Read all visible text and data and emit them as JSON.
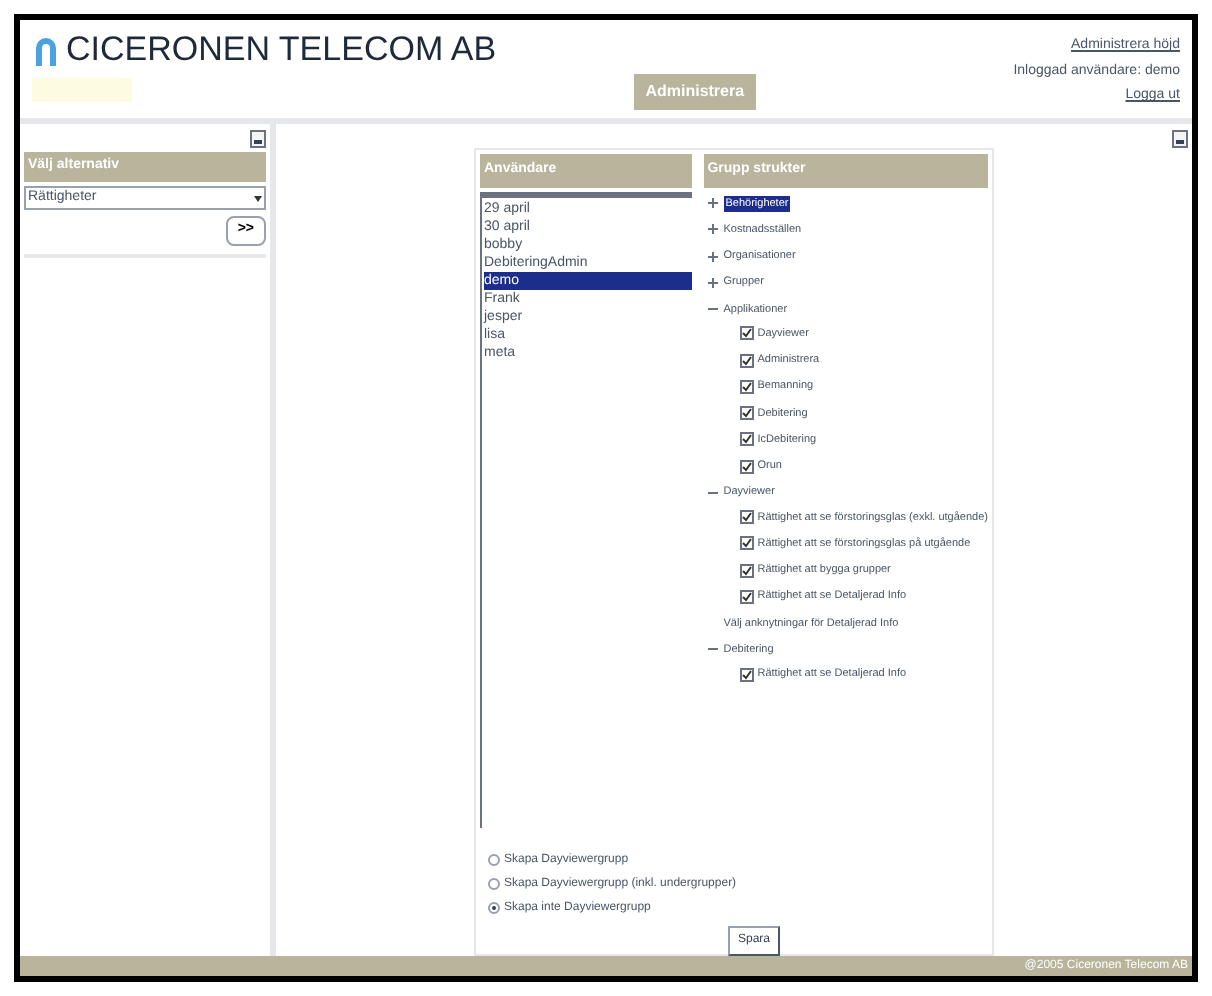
{
  "header": {
    "company": "CICERONEN TELECOM AB",
    "nav_tabs": [
      {
        "label": "Administrera",
        "selected": true
      }
    ],
    "links": [
      {
        "kind": "link",
        "text": "Administrera höjd"
      },
      {
        "kind": "text",
        "text": "Inloggad användare: demo"
      },
      {
        "kind": "link",
        "text": "Logga ut"
      }
    ]
  },
  "sidebar": {
    "title": "Välj alternativ",
    "select_value": "Rättigheter",
    "go_button": ">>"
  },
  "users": {
    "title": "Användare",
    "items": [
      {
        "label": "29 april",
        "selected": false
      },
      {
        "label": "30 april",
        "selected": false
      },
      {
        "label": "bobby",
        "selected": false
      },
      {
        "label": "DebiteringAdmin",
        "selected": false
      },
      {
        "label": "demo",
        "selected": true
      },
      {
        "label": "Frank",
        "selected": false
      },
      {
        "label": "jesper",
        "selected": false
      },
      {
        "label": "lisa",
        "selected": false
      },
      {
        "label": "meta",
        "selected": false
      }
    ]
  },
  "tree": {
    "title": "Grupp strukter",
    "items": [
      {
        "kind": "node",
        "label": "Behörigheter",
        "expanded": false,
        "selected": true
      },
      {
        "kind": "node",
        "label": "Kostnadsställen",
        "expanded": false,
        "selected": false
      },
      {
        "kind": "node",
        "label": "Organisationer",
        "expanded": false,
        "selected": false
      },
      {
        "kind": "node",
        "label": "Grupper",
        "expanded": false,
        "selected": false
      },
      {
        "kind": "node",
        "label": "Applikationer",
        "expanded": true,
        "selected": false,
        "children": [
          {
            "kind": "checkbox",
            "label": "Dayviewer",
            "checked": true
          },
          {
            "kind": "checkbox",
            "label": "Administrera",
            "checked": true
          },
          {
            "kind": "checkbox",
            "label": "Bemanning",
            "checked": true
          },
          {
            "kind": "checkbox",
            "label": "Debitering",
            "checked": true
          },
          {
            "kind": "checkbox",
            "label": "IcDebitering",
            "checked": true
          },
          {
            "kind": "checkbox",
            "label": "Orun",
            "checked": true
          }
        ]
      },
      {
        "kind": "node",
        "label": "Dayviewer",
        "expanded": true,
        "selected": false,
        "children": [
          {
            "kind": "checkbox",
            "label": "Rättighet att se förstoringsglas (exkl. utgående)",
            "checked": true
          },
          {
            "kind": "checkbox",
            "label": "Rättighet att se förstoringsglas på utgående",
            "checked": true
          },
          {
            "kind": "checkbox",
            "label": "Rättighet att bygga grupper",
            "checked": true
          },
          {
            "kind": "checkbox",
            "label": "Rättighet att se Detaljerad Info",
            "checked": true
          },
          {
            "kind": "text",
            "label": "Välj anknytningar för Detaljerad Info"
          }
        ]
      },
      {
        "kind": "node",
        "label": "Debitering",
        "expanded": true,
        "selected": false,
        "children": [
          {
            "kind": "checkbox",
            "label": "Rättighet att se Detaljerad Info",
            "checked": true
          }
        ]
      }
    ]
  },
  "options": [
    {
      "label": "Skapa Dayviewergrupp",
      "selected": false
    },
    {
      "label": "Skapa Dayviewergrupp (inkl. undergrupper)",
      "selected": false
    },
    {
      "label": "Skapa inte Dayviewergrupp",
      "selected": true
    }
  ],
  "save_button": "Spara",
  "footer": "@2005 Ciceronen Telecom AB"
}
